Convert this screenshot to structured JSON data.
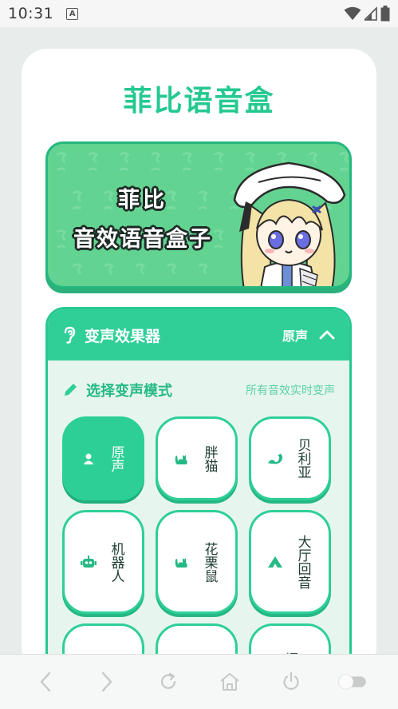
{
  "status_bar": {
    "time": "10:31",
    "notification_icon": "A"
  },
  "app": {
    "title": "菲比语音盒"
  },
  "banner": {
    "line1": "菲比",
    "line2": "音效语音盒子"
  },
  "voice_changer": {
    "title": "变声效果器",
    "current_mode": "原声",
    "select_label": "选择变声模式",
    "select_hint": "所有音效实时变声",
    "modes": [
      {
        "label": "原声",
        "icon": "person-icon",
        "active": true
      },
      {
        "label": "胖猫",
        "icon": "cat-icon",
        "active": false
      },
      {
        "label": "贝利亚",
        "icon": "dragon-icon",
        "active": false
      },
      {
        "label": "机器人",
        "icon": "robot-icon",
        "active": false
      },
      {
        "label": "花栗鼠",
        "icon": "cat-icon",
        "active": false
      },
      {
        "label": "大厅回音",
        "icon": "mountain-icon",
        "active": false
      },
      {
        "label": "",
        "icon": "",
        "active": false
      },
      {
        "label": "",
        "icon": "",
        "active": false
      },
      {
        "label": "爆音",
        "icon": "",
        "active": false
      }
    ]
  },
  "colors": {
    "accent": "#2fcf97",
    "accent_dark": "#25b885",
    "panel_bg": "#e6f6ef"
  },
  "bottom_nav": [
    "back-icon",
    "forward-icon",
    "refresh-icon",
    "home-icon",
    "power-icon",
    "toggle-icon"
  ]
}
